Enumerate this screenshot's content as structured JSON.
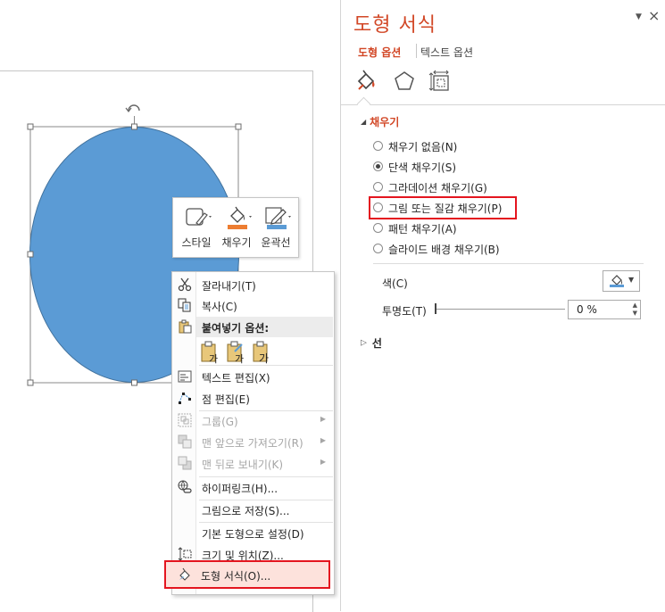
{
  "colors": {
    "accent": "#d24726",
    "shape_fill": "#5b9bd5",
    "highlight": "#e4151f"
  },
  "mini_toolbar": {
    "buttons": [
      {
        "label": "스타일",
        "icon": "style-icon"
      },
      {
        "label": "채우기",
        "icon": "fill-bucket-icon"
      },
      {
        "label": "윤곽선",
        "icon": "outline-pen-icon"
      }
    ]
  },
  "context_menu": {
    "cut": "잘라내기(T)",
    "copy": "복사(C)",
    "paste_options_header": "붙여넣기 옵션:",
    "paste_option_labels": [
      "가"
    ],
    "edit_text": "텍스트 편집(X)",
    "edit_points": "점 편집(E)",
    "group": "그룹(G)",
    "bring_to_front": "맨 앞으로 가져오기(R)",
    "send_to_back": "맨 뒤로 보내기(K)",
    "hyperlink": "하이퍼링크(H)...",
    "save_as_picture": "그림으로 저장(S)...",
    "set_default_shape": "기본 도형으로 설정(D)",
    "size_position": "크기 및 위치(Z)...",
    "format_shape": "도형 서식(O)..."
  },
  "format_pane": {
    "title": "도형 서식",
    "tabs": {
      "shape_options": "도형 옵션",
      "text_options": "텍스트 옵션"
    },
    "fill_section": {
      "title": "채우기",
      "options": [
        {
          "label": "채우기 없음(N)",
          "checked": false
        },
        {
          "label": "단색 채우기(S)",
          "checked": true
        },
        {
          "label": "그라데이션 채우기(G)",
          "checked": false
        },
        {
          "label": "그림 또는 질감 채우기(P)",
          "checked": false
        },
        {
          "label": "패턴 채우기(A)",
          "checked": false
        },
        {
          "label": "슬라이드 배경 채우기(B)",
          "checked": false
        }
      ],
      "color_label": "색(C)",
      "transparency_label": "투명도(T)",
      "transparency_value": "0 %",
      "transparency_level": 0
    },
    "line_section": {
      "title": "선"
    }
  }
}
